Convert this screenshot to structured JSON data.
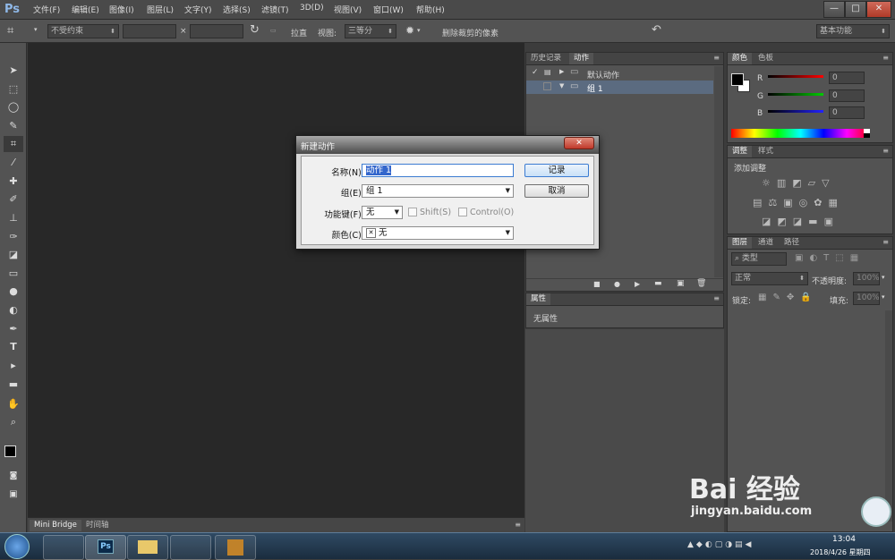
{
  "app": {
    "logo": "Ps"
  },
  "menu": [
    "文件(F)",
    "编辑(E)",
    "图像(I)",
    "图层(L)",
    "文字(Y)",
    "选择(S)",
    "滤镜(T)",
    "3D(D)",
    "视图(V)",
    "窗口(W)",
    "帮助(H)"
  ],
  "window_controls": {
    "minimize": "—",
    "maximize": "□",
    "close": "✕"
  },
  "options": {
    "ratio": "不受约束",
    "times": "×",
    "straighten": "拉直",
    "view_label": "视图:",
    "view_value": "三等分",
    "delete_cropped": "删除裁剪的像素",
    "workspace": "基本功能"
  },
  "history_panel": {
    "tabs": [
      "历史记录",
      "动作"
    ],
    "rows": [
      {
        "name": "默认动作",
        "selected": false
      },
      {
        "name": "组 1",
        "selected": true
      }
    ]
  },
  "properties_panel": {
    "tab": "属性",
    "text": "无属性"
  },
  "color_panel": {
    "tabs": [
      "颜色",
      "色板"
    ],
    "channels": [
      {
        "label": "R",
        "value": "0"
      },
      {
        "label": "G",
        "value": "0"
      },
      {
        "label": "B",
        "value": "0"
      }
    ]
  },
  "adjust_panel": {
    "tabs": [
      "调整",
      "样式"
    ],
    "title": "添加调整"
  },
  "layers_panel": {
    "tabs": [
      "图层",
      "通道",
      "路径"
    ],
    "kind": "类型",
    "blend": "正常",
    "opacity_label": "不透明度:",
    "opacity_value": "100%",
    "lock_label": "锁定:",
    "fill_label": "填充:",
    "fill_value": "100%"
  },
  "bottom_tabs": [
    "Mini Bridge",
    "时间轴"
  ],
  "dialog": {
    "title": "新建动作",
    "name_label": "名称(N):",
    "name_value": "动作 1",
    "group_label": "组(E):",
    "group_value": "组 1",
    "fkey_label": "功能键(F):",
    "fkey_value": "无",
    "shift_label": "Shift(S)",
    "control_label": "Control(O)",
    "color_label": "颜色(C):",
    "color_value": "无",
    "record_button": "记录",
    "cancel_button": "取消",
    "close_glyph": "✕"
  },
  "taskbar": {
    "time": "13:04",
    "date": "2018/4/26 星期四"
  },
  "watermark": {
    "brand": "Bai 经验",
    "url": "jingyan.baidu.com"
  }
}
